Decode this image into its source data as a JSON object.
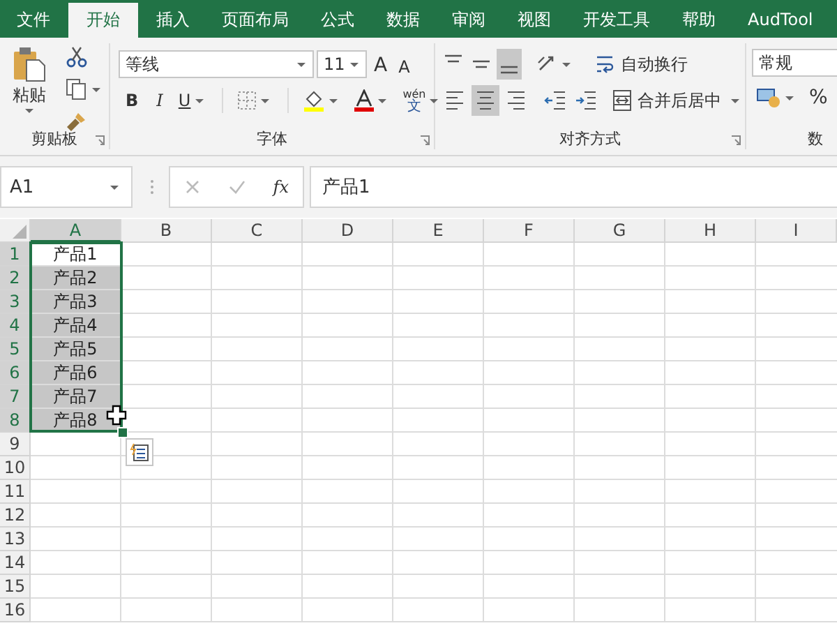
{
  "tabs": [
    {
      "label": "文件",
      "selected": false
    },
    {
      "label": "开始",
      "selected": true
    },
    {
      "label": "插入",
      "selected": false
    },
    {
      "label": "页面布局",
      "selected": false
    },
    {
      "label": "公式",
      "selected": false
    },
    {
      "label": "数据",
      "selected": false
    },
    {
      "label": "审阅",
      "selected": false
    },
    {
      "label": "视图",
      "selected": false
    },
    {
      "label": "开发工具",
      "selected": false
    },
    {
      "label": "帮助",
      "selected": false
    },
    {
      "label": "AudTool",
      "selected": false
    }
  ],
  "clipboard": {
    "paste_label": "粘贴",
    "group_label": "剪贴板"
  },
  "font": {
    "name": "等线",
    "size": "11",
    "grow_shrink": [
      "A",
      "A"
    ],
    "bold": "B",
    "italic": "I",
    "underline": "U",
    "phonetic_top": "wén",
    "phonetic_bottom": "文",
    "group_label": "字体"
  },
  "alignment": {
    "row1": [
      {
        "kind": "top",
        "pressed": false
      },
      {
        "kind": "middle",
        "pressed": false
      },
      {
        "kind": "bottom",
        "pressed": true
      },
      {
        "kind": "orientation",
        "pressed": false
      }
    ],
    "row2": [
      {
        "kind": "left",
        "pressed": false
      },
      {
        "kind": "center",
        "pressed": true
      },
      {
        "kind": "right",
        "pressed": false
      },
      {
        "kind": "outdent",
        "pressed": false
      },
      {
        "kind": "indent",
        "pressed": false
      }
    ],
    "wrap_label": "自动换行",
    "merge_label": "合并后居中",
    "group_label": "对齐方式"
  },
  "number": {
    "format": "常规",
    "percent": "%",
    "group_label": "数"
  },
  "name_box": "A1",
  "fx": "fx",
  "formula": "产品1",
  "columns": [
    {
      "label": "A",
      "selected": true
    },
    {
      "label": "B",
      "selected": false
    },
    {
      "label": "C",
      "selected": false
    },
    {
      "label": "D",
      "selected": false
    },
    {
      "label": "E",
      "selected": false
    },
    {
      "label": "F",
      "selected": false
    },
    {
      "label": "G",
      "selected": false
    },
    {
      "label": "H",
      "selected": false
    },
    {
      "label": "I",
      "selected": false
    }
  ],
  "rows": [
    {
      "header": "1",
      "selected": true,
      "active": true,
      "value": "产品1"
    },
    {
      "header": "2",
      "selected": true,
      "active": false,
      "value": "产品2"
    },
    {
      "header": "3",
      "selected": true,
      "active": false,
      "value": "产品3"
    },
    {
      "header": "4",
      "selected": true,
      "active": false,
      "value": "产品4"
    },
    {
      "header": "5",
      "selected": true,
      "active": false,
      "value": "产品5"
    },
    {
      "header": "6",
      "selected": true,
      "active": false,
      "value": "产品6"
    },
    {
      "header": "7",
      "selected": true,
      "active": false,
      "value": "产品7"
    },
    {
      "header": "8",
      "selected": true,
      "active": false,
      "value": "产品8"
    },
    {
      "header": "9",
      "selected": false
    },
    {
      "header": "10",
      "selected": false
    },
    {
      "header": "11",
      "selected": false
    },
    {
      "header": "12",
      "selected": false
    },
    {
      "header": "13",
      "selected": false
    },
    {
      "header": "14",
      "selected": false
    },
    {
      "header": "15",
      "selected": false
    },
    {
      "header": "16",
      "selected": false
    }
  ]
}
